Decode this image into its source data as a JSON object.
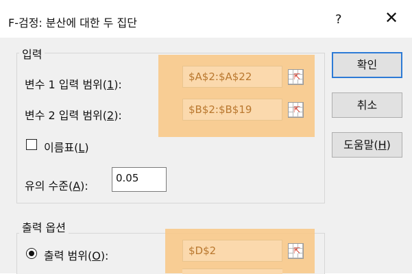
{
  "window": {
    "title": "F-검정: 분산에 대한 두 집단",
    "help": "?",
    "close": "✕"
  },
  "input_group": {
    "legend": "입력",
    "var1": {
      "label_prefix": "변수 1 입력 범위(",
      "label_key": "1",
      "label_suffix": "):",
      "value": "$A$2:$A$22"
    },
    "var2": {
      "label_prefix": "변수 2 입력 범위(",
      "label_key": "2",
      "label_suffix": "):",
      "value": "$B$2:$B$19"
    },
    "labels_checkbox": {
      "label_prefix": "이름표(",
      "label_key": "L",
      "label_suffix": ")",
      "checked": false
    },
    "alpha": {
      "label_prefix": "유의 수준(",
      "label_key": "A",
      "label_suffix": "):",
      "value": "0.05"
    }
  },
  "output_group": {
    "legend": "출력 옵션",
    "output_range": {
      "label_prefix": "출력 범위(",
      "label_key": "O",
      "label_suffix": "):",
      "value": "$D$2",
      "selected": true
    }
  },
  "buttons": {
    "ok": "확인",
    "cancel": "취소",
    "help_prefix": "도움말(",
    "help_key": "H",
    "help_suffix": ")"
  },
  "colors": {
    "highlight": "#f8c98a",
    "range_text": "#b9772e",
    "focus_border": "#2c7ad6"
  },
  "icons": {
    "range_picker": "range-select-icon",
    "close": "close-icon"
  }
}
